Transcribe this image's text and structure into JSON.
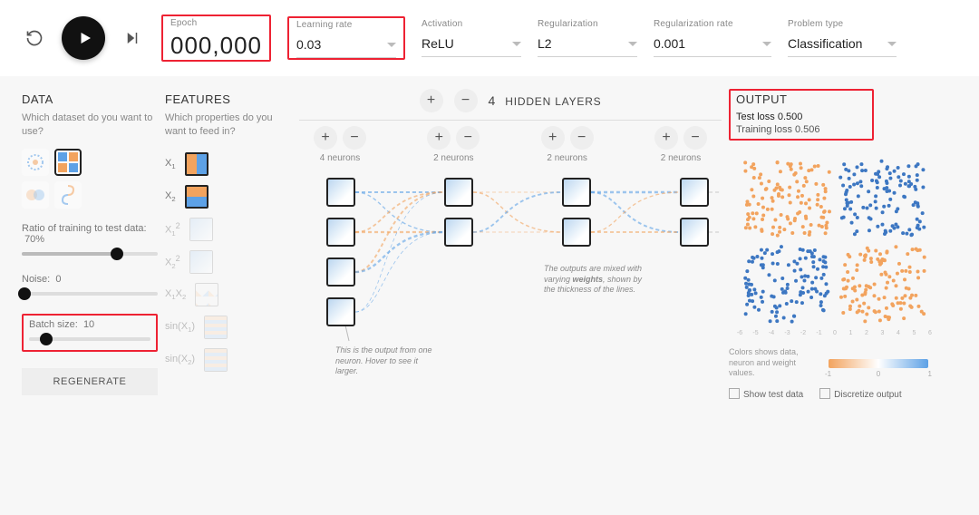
{
  "topbar": {
    "epoch": {
      "label": "Epoch",
      "value": "000,000"
    },
    "learning_rate": {
      "label": "Learning rate",
      "value": "0.03"
    },
    "activation": {
      "label": "Activation",
      "value": "ReLU"
    },
    "regularization": {
      "label": "Regularization",
      "value": "L2"
    },
    "regularization_rate": {
      "label": "Regularization rate",
      "value": "0.001"
    },
    "problem_type": {
      "label": "Problem type",
      "value": "Classification"
    }
  },
  "data": {
    "heading": "DATA",
    "subtitle": "Which dataset do you want to use?",
    "datasets": [
      "circle",
      "xor",
      "gauss",
      "spiral"
    ],
    "selected_dataset": "xor",
    "ratio": {
      "label": "Ratio of training to test data:",
      "value": "70%",
      "pct": 70
    },
    "noise": {
      "label": "Noise:",
      "value": "0",
      "pct": 2
    },
    "batch": {
      "label": "Batch size:",
      "value": "10",
      "pct": 14
    },
    "regenerate": "REGENERATE"
  },
  "features": {
    "heading": "FEATURES",
    "subtitle": "Which properties do you want to feed in?",
    "items": [
      {
        "key": "x1",
        "label": "X",
        "sub": "1",
        "active": true
      },
      {
        "key": "x2",
        "label": "X",
        "sub": "2",
        "active": true
      },
      {
        "key": "x1sq",
        "label": "X",
        "sub": "1",
        "sup": "2",
        "active": false
      },
      {
        "key": "x2sq",
        "label": "X",
        "sub": "2",
        "sup": "2",
        "active": false
      },
      {
        "key": "x1x2",
        "label": "X",
        "sub": "1",
        "label2": "X",
        "sub2": "2",
        "active": false
      },
      {
        "key": "sinx1",
        "label": "sin(X",
        "sub": "1",
        "close": ")",
        "active": false
      },
      {
        "key": "sinx2",
        "label": "sin(X",
        "sub": "2",
        "close": ")",
        "active": false
      }
    ]
  },
  "network": {
    "hidden_label": "HIDDEN LAYERS",
    "hidden_count": "4",
    "layers": [
      {
        "neurons": 4,
        "label": "4 neurons"
      },
      {
        "neurons": 2,
        "label": "2 neurons"
      },
      {
        "neurons": 2,
        "label": "2 neurons"
      },
      {
        "neurons": 2,
        "label": "2 neurons"
      }
    ],
    "tip_neuron": "This is the output from one neuron. Hover to see it larger.",
    "tip_weights": "The outputs are mixed with varying weights, shown by the thickness of the lines."
  },
  "output": {
    "heading": "OUTPUT",
    "test_loss": "Test loss 0.500",
    "training_loss": "Training loss 0.506",
    "axis_ticks": [
      "-6",
      "-5",
      "-4",
      "-3",
      "-2",
      "-1",
      "0",
      "1",
      "2",
      "3",
      "4",
      "5",
      "6"
    ],
    "legend_text": "Colors shows data, neuron and weight values.",
    "legend_min": "-1",
    "legend_mid": "0",
    "legend_max": "1",
    "show_test": "Show test data",
    "discretize": "Discretize output"
  },
  "colors": {
    "orange": "#f2a35e",
    "blue": "#5da1e6",
    "gray": "#888"
  }
}
